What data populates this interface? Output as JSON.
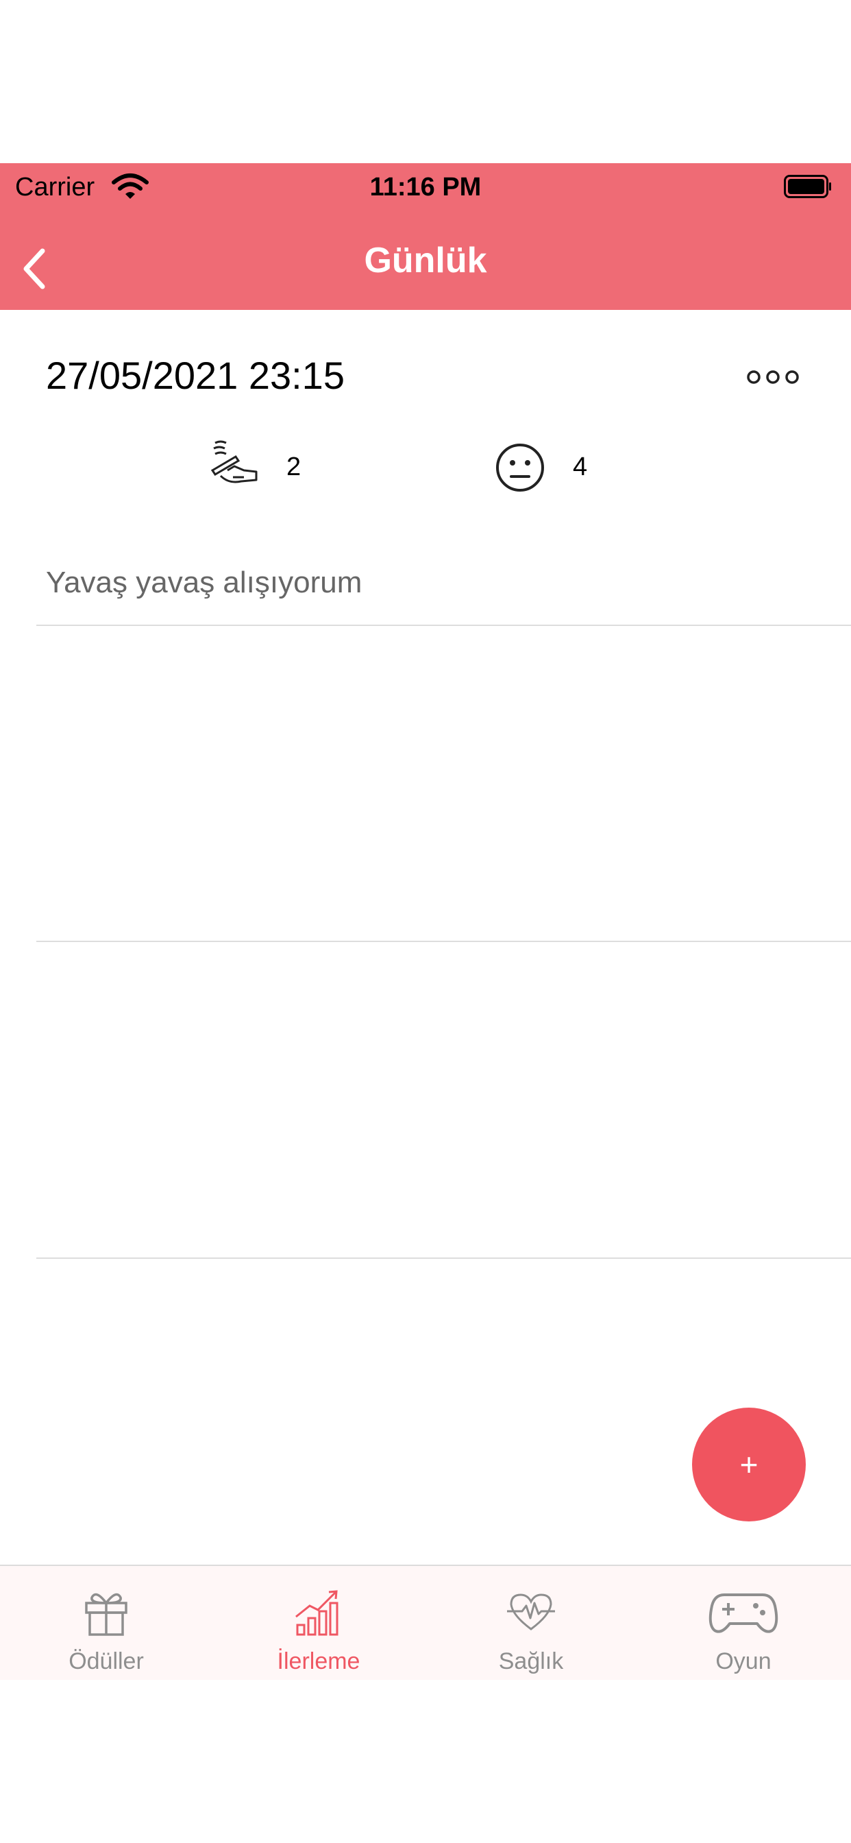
{
  "status_bar": {
    "carrier": "Carrier",
    "time": "11:16 PM"
  },
  "nav": {
    "title": "Günlük",
    "back_icon": "chevron-left-icon"
  },
  "entry": {
    "datetime": "27/05/2021 23:15",
    "more_icon": "more-dots-icon",
    "cigarette_icon": "smoking-hand-icon",
    "cigarette_count": "2",
    "mood_icon": "neutral-face-icon",
    "mood_value": "4",
    "note": "Yavaş yavaş alışıyorum"
  },
  "fab": {
    "label": "+"
  },
  "tabs": [
    {
      "label": "Ödüller",
      "icon": "gift-icon",
      "active": false
    },
    {
      "label": "İlerleme",
      "icon": "growth-chart-icon",
      "active": true
    },
    {
      "label": "Sağlık",
      "icon": "heartbeat-icon",
      "active": false
    },
    {
      "label": "Oyun",
      "icon": "gamepad-icon",
      "active": false
    }
  ],
  "colors": {
    "accent": "#ef6b75",
    "fab": "#f0545f",
    "active_tab": "#ef5763",
    "inactive_tab": "#8e8e8e"
  }
}
